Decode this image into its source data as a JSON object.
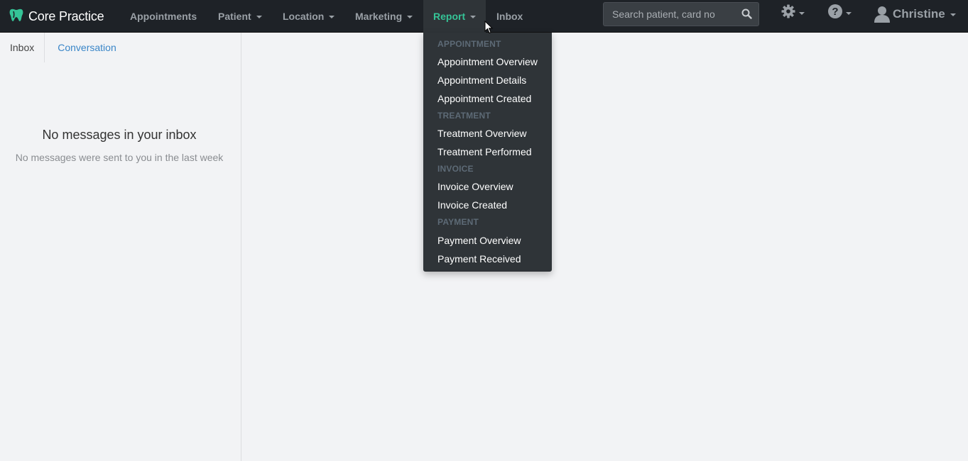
{
  "brand": {
    "name": "Core Practice",
    "logo_icon": "tooth-icon",
    "logo_color": "#35c497"
  },
  "nav": {
    "appointments": "Appointments",
    "patient": "Patient",
    "location": "Location",
    "marketing": "Marketing",
    "report": "Report",
    "inbox": "Inbox"
  },
  "search": {
    "placeholder": "Search patient, card no",
    "icon": "search-icon"
  },
  "toolbar": {
    "settings_icon": "gear-icon",
    "help_icon": "help-icon"
  },
  "user": {
    "name": "Christine",
    "icon": "user-icon"
  },
  "tabs": {
    "inbox": "Inbox",
    "conversation": "Conversation"
  },
  "empty_state": {
    "title": "No messages in your inbox",
    "subtitle": "No messages were sent to you in the last week"
  },
  "report_menu": {
    "sections": [
      {
        "header": "APPOINTMENT",
        "items": [
          "Appointment Overview",
          "Appointment Details",
          "Appointment Created"
        ]
      },
      {
        "header": "TREATMENT",
        "items": [
          "Treatment Overview",
          "Treatment Performed"
        ]
      },
      {
        "header": "INVOICE",
        "items": [
          "Invoice Overview",
          "Invoice Created"
        ]
      },
      {
        "header": "PAYMENT",
        "items": [
          "Payment Overview",
          "Payment Received"
        ]
      }
    ]
  },
  "colors": {
    "navbar": "#1e2227",
    "active": "#35c497",
    "menu_bg": "#2f3438",
    "link": "#3a86c8"
  }
}
